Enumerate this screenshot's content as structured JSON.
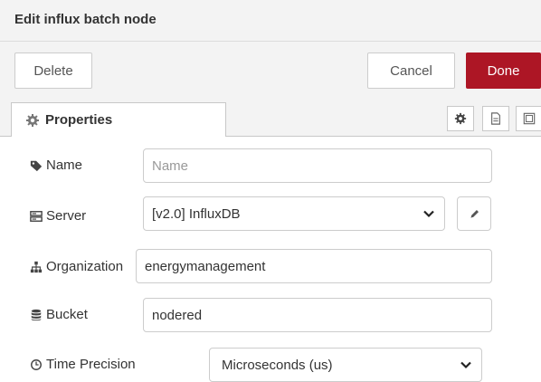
{
  "dialog": {
    "title": "Edit influx batch node"
  },
  "buttons": {
    "delete": "Delete",
    "cancel": "Cancel",
    "done": "Done",
    "done_color": "#ad1625"
  },
  "tabs": {
    "properties": "Properties",
    "active": "Properties"
  },
  "icons": {
    "properties_tab": "gear-icon",
    "settings_tab": "gear-icon",
    "description_tab": "document-icon",
    "appearance_tab": "layout-icon",
    "name": "tag-icon",
    "server": "server-icon",
    "organization": "sitemap-icon",
    "bucket": "database-icon",
    "time_precision": "clock-icon",
    "edit_server": "pencil-icon"
  },
  "form": {
    "name": {
      "label": "Name",
      "value": "",
      "placeholder": "Name"
    },
    "server": {
      "label": "Server",
      "value": "[v2.0] InfluxDB"
    },
    "organization": {
      "label": "Organization",
      "value": "energymanagement"
    },
    "bucket": {
      "label": "Bucket",
      "value": "nodered"
    },
    "time_precision": {
      "label": "Time Precision",
      "value": "Microseconds (us)"
    }
  }
}
